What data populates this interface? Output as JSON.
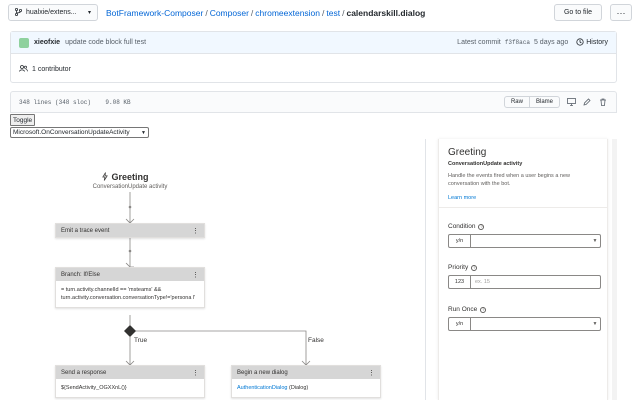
{
  "header": {
    "branch": "hualxie/extens...",
    "breadcrumb": [
      "BotFramework-Composer",
      "Composer",
      "chromeextension",
      "test"
    ],
    "file": "calendarskill.dialog",
    "separator": "/",
    "goto_label": "Go to file",
    "more_label": "···"
  },
  "commit": {
    "author": "xieofxie",
    "message": "update code block full test",
    "latest_label": "Latest commit",
    "sha": "f3f8aca",
    "when": "5 days ago",
    "history_label": "History"
  },
  "contributors": {
    "label": "1 contributor"
  },
  "file_header": {
    "info": "348 lines (348 sloc)    9.08 KB",
    "raw_label": "Raw",
    "blame_label": "Blame"
  },
  "controls": {
    "toggle_label": "Toggle",
    "trigger_select": "Microsoft.OnConversationUpdateActivity"
  },
  "flow": {
    "trigger_title": "Greeting",
    "trigger_subtitle": "ConversationUpdate activity",
    "node_emit": "Emit a trace event",
    "node_branch": "Branch: If/Else",
    "branch_condition": "= turn.activity.channelId == 'msteams' && turn.activity.conversation.conversationType!='persona l'",
    "true_label": "True",
    "false_label": "False",
    "node_send": "Send a response",
    "send_body": "${SendActivity_OGXXnL()}",
    "node_dialog": "Begin a new dialog",
    "dialog_link": "AuthenticationDialog",
    "dialog_suffix": " (Dialog)",
    "menu_dots": "⋮"
  },
  "panel": {
    "title": "Greeting",
    "kind": "ConversationUpdate activity",
    "description": "Handle the events fired when a user begins a new conversation with the bot.",
    "learn_more": "Learn more",
    "condition_label": "Condition",
    "condition_type": "y/n",
    "priority_label": "Priority",
    "priority_type": "123",
    "priority_placeholder": "ex. 15",
    "runonce_label": "Run Once",
    "runonce_type": "y/n"
  }
}
